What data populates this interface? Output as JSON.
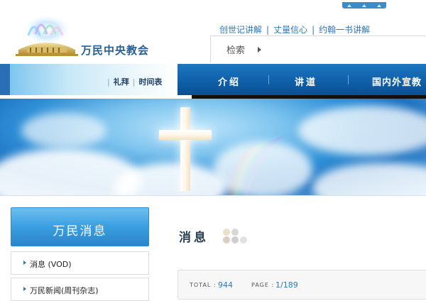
{
  "logo": {
    "name": "万民中央教会",
    "icon": "church-logo-icon"
  },
  "top_links": [
    "创世记讲解",
    "丈量信心",
    "约翰一书讲解"
  ],
  "top_links_separator": "|",
  "search": {
    "label": "检索"
  },
  "nav": {
    "sub_items": [
      "礼拜",
      "时间表"
    ],
    "items": [
      "介绍",
      "讲道",
      "国内外宣教"
    ]
  },
  "sidebar": {
    "title": "万民消息",
    "items": [
      "消息 (VOD)",
      "万民新闻(周刊杂志)"
    ]
  },
  "content": {
    "title": "消息",
    "total_label": "TOTAL :",
    "total_value": "944",
    "page_label": "PAGE :",
    "page_value": "1/189"
  },
  "colors": {
    "accent": "#2f78b8",
    "nav": "#0f5ea8"
  }
}
